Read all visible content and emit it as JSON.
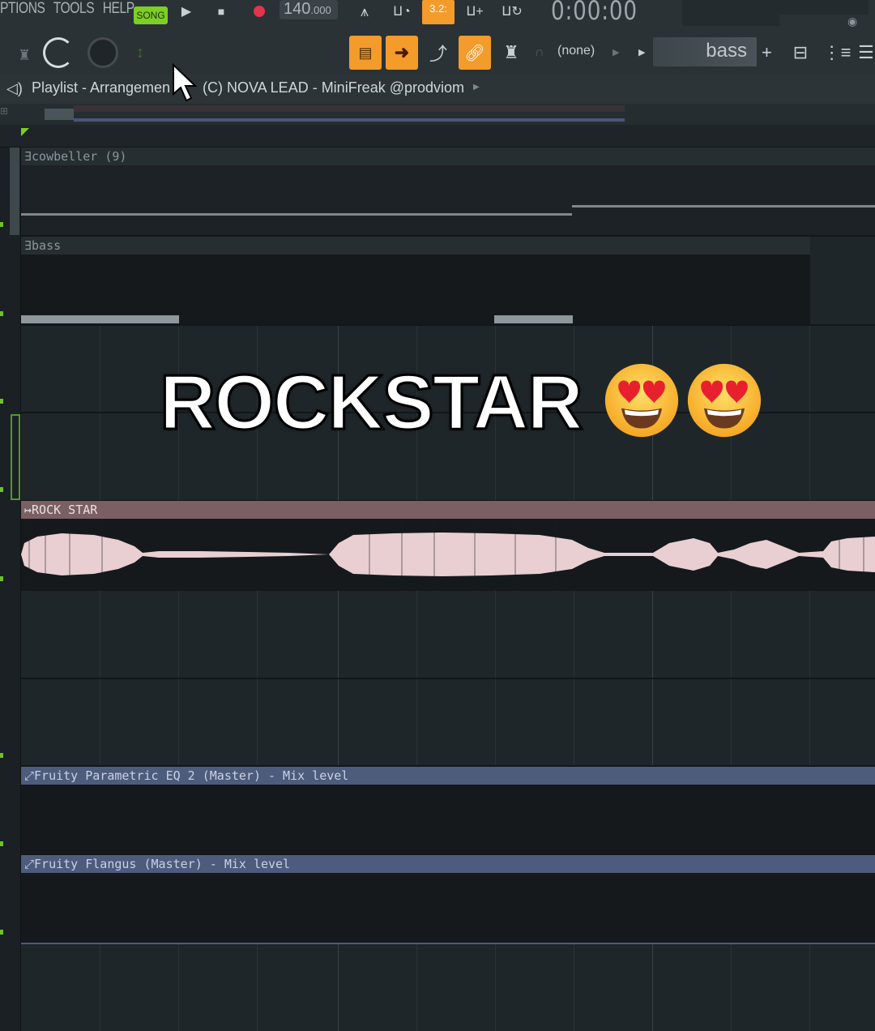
{
  "menu": [
    "PTIONS",
    "TOOLS",
    "HELP"
  ],
  "transport": {
    "mode": "SONG",
    "tempo_main": "140",
    "tempo_fraction": ".000",
    "snap_label": "3.2:",
    "time": "0:00:00"
  },
  "toolbar": {
    "snap_select": "(none)",
    "pattern_name": "bass"
  },
  "playlist": {
    "title": "Playlist - Arrangemen",
    "pattern": "(C) NOVA LEAD - MiniFreak @prodviom"
  },
  "tracks": [
    {
      "label": "cowbeller (9)",
      "type": "pattern"
    },
    {
      "label": "bass",
      "type": "pattern"
    },
    {
      "label": "ROCK STAR",
      "type": "audio"
    },
    {
      "label": "Fruity Parametric EQ 2 (Master) - Mix level",
      "type": "automation"
    },
    {
      "label": "Fruity Flangus (Master) - Mix level",
      "type": "automation"
    }
  ],
  "overlay": {
    "caption": "ROCKSTAR",
    "emoji": [
      "heart-eyes-emoji",
      "heart-eyes-emoji"
    ]
  },
  "colors": {
    "accent_orange": "#f39b2b",
    "song_green": "#7ecf24",
    "audio_clip": "#7a5f63",
    "automation_clip": "#4d5b7d"
  }
}
